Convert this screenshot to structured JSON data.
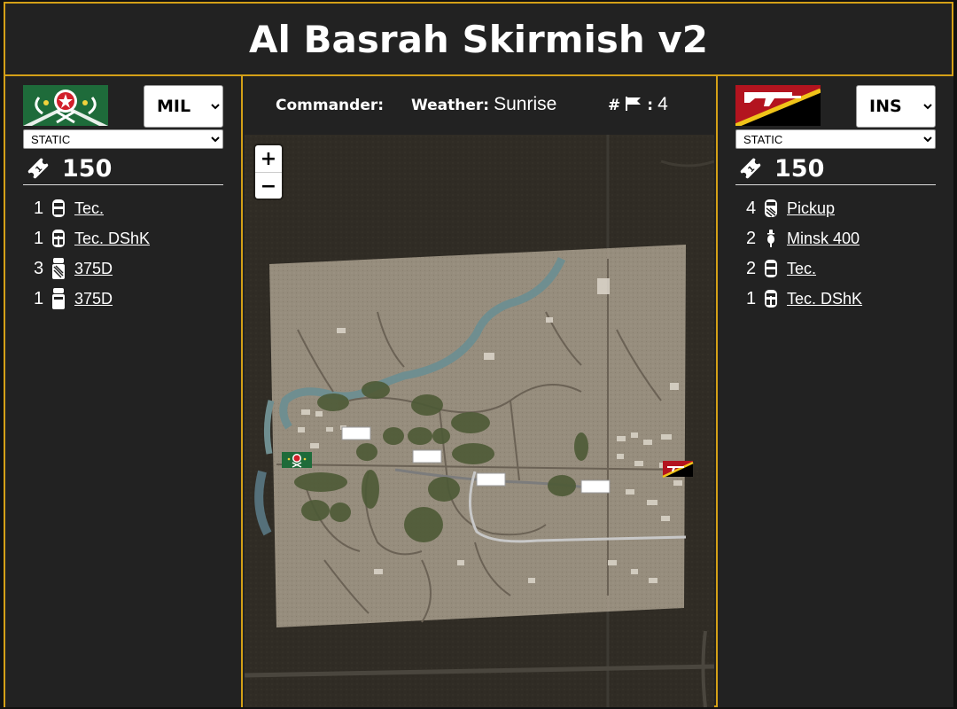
{
  "page": {
    "title": "Al Basrah Skirmish v2"
  },
  "left_team": {
    "faction": "MIL",
    "mode": "STATIC",
    "points": "150",
    "flag_colors": {
      "primary": "#1e6b3a",
      "secondary": "#ffffff",
      "accent": "#d11f2a"
    },
    "units": [
      {
        "count": "1",
        "name": "Tec.",
        "icon": "technical-icon"
      },
      {
        "count": "1",
        "name": "Tec. DShK",
        "icon": "technical-gun-icon"
      },
      {
        "count": "3",
        "name": "375D",
        "icon": "truck-icon"
      },
      {
        "count": "1",
        "name": "375D",
        "icon": "truck-icon"
      }
    ]
  },
  "right_team": {
    "faction": "INS",
    "mode": "STATIC",
    "points": "150",
    "flag_colors": {
      "primary": "#b3141f",
      "secondary": "#000000",
      "accent": "#f0c419"
    },
    "units": [
      {
        "count": "4",
        "name": "Pickup",
        "icon": "pickup-icon"
      },
      {
        "count": "2",
        "name": "Minsk 400",
        "icon": "motorbike-icon"
      },
      {
        "count": "2",
        "name": "Tec.",
        "icon": "technical-icon"
      },
      {
        "count": "1",
        "name": "Tec. DShK",
        "icon": "technical-gun-icon"
      }
    ]
  },
  "info": {
    "commander_label": "Commander:",
    "commander_value": "",
    "weather_label": "Weather:",
    "weather_value": "Sunrise",
    "flags_label": "#",
    "flags_sep": ":",
    "flags_value": "4"
  },
  "map": {
    "zoom_in": "+",
    "zoom_out": "−"
  },
  "colors": {
    "border": "#d4a017",
    "background": "#222222",
    "text": "#ffffff"
  }
}
